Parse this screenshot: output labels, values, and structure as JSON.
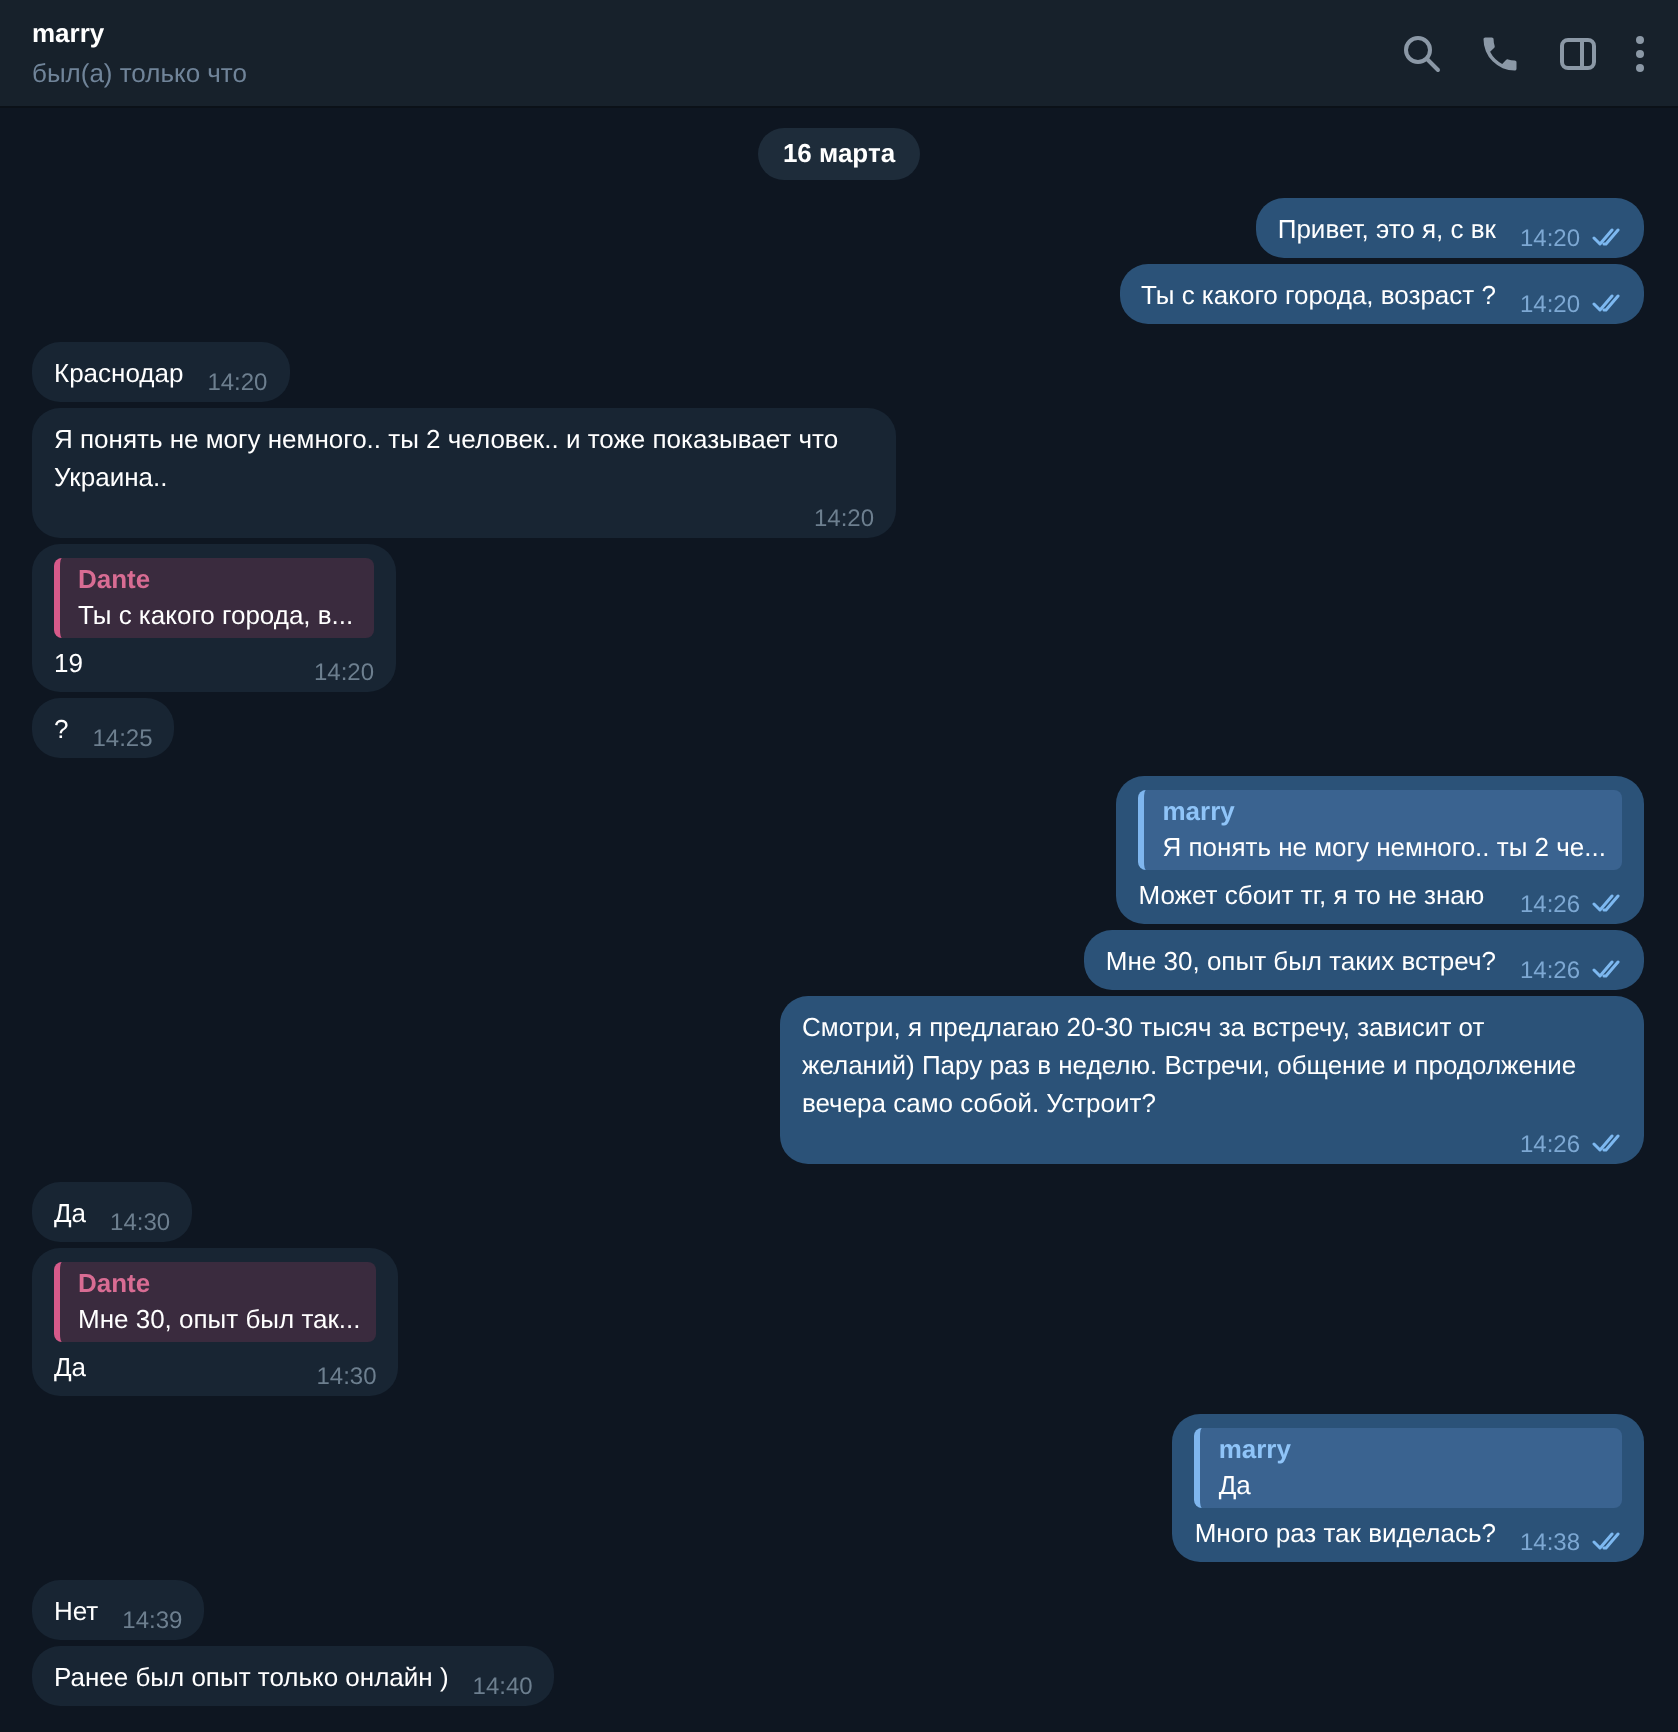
{
  "header": {
    "name": "marry",
    "status": "был(а) только что"
  },
  "date": "16 марта",
  "groups": [
    {
      "outgoing": true,
      "messages": [
        {
          "text": "Привет, это я, с вк",
          "time": "14:20",
          "read": true
        },
        {
          "text": "Ты с какого города, возраст ?",
          "time": "14:20",
          "read": true
        }
      ]
    },
    {
      "outgoing": false,
      "messages": [
        {
          "text": "Краснодар",
          "time": "14:20"
        },
        {
          "text": "Я понять не могу немного.. ты 2 человек.. и тоже показывает что Украина..",
          "time": "14:20"
        },
        {
          "reply": {
            "name": "Dante",
            "text": "Ты с какого города, в..."
          },
          "text": "19",
          "time": "14:20"
        },
        {
          "text": "?",
          "time": "14:25"
        }
      ]
    },
    {
      "outgoing": true,
      "messages": [
        {
          "reply": {
            "name": "marry",
            "text": "Я понять не могу немного.. ты 2 че..."
          },
          "text": "Может сбоит тг, я то не знаю",
          "time": "14:26",
          "read": true
        },
        {
          "text": "Мне 30, опыт был таких встреч?",
          "time": "14:26",
          "read": true
        },
        {
          "text": "Смотри, я предлагаю 20-30 тысяч за встречу, зависит от желаний) Пару раз в неделю. Встречи, общение и продолжение вечера само собой.  Устроит?",
          "time": "14:26",
          "read": true
        }
      ]
    },
    {
      "outgoing": false,
      "messages": [
        {
          "text": "Да",
          "time": "14:30"
        },
        {
          "reply": {
            "name": "Dante",
            "text": "Мне 30, опыт был так..."
          },
          "text": "Да",
          "time": "14:30"
        }
      ]
    },
    {
      "outgoing": true,
      "messages": [
        {
          "reply": {
            "name": "marry",
            "text": "Да"
          },
          "text": "Много раз так виделась?",
          "time": "14:38",
          "read": true
        }
      ]
    },
    {
      "outgoing": false,
      "messages": [
        {
          "text": "Нет",
          "time": "14:39"
        },
        {
          "text": "Ранее был опыт только онлайн )",
          "time": "14:40"
        }
      ]
    }
  ]
}
